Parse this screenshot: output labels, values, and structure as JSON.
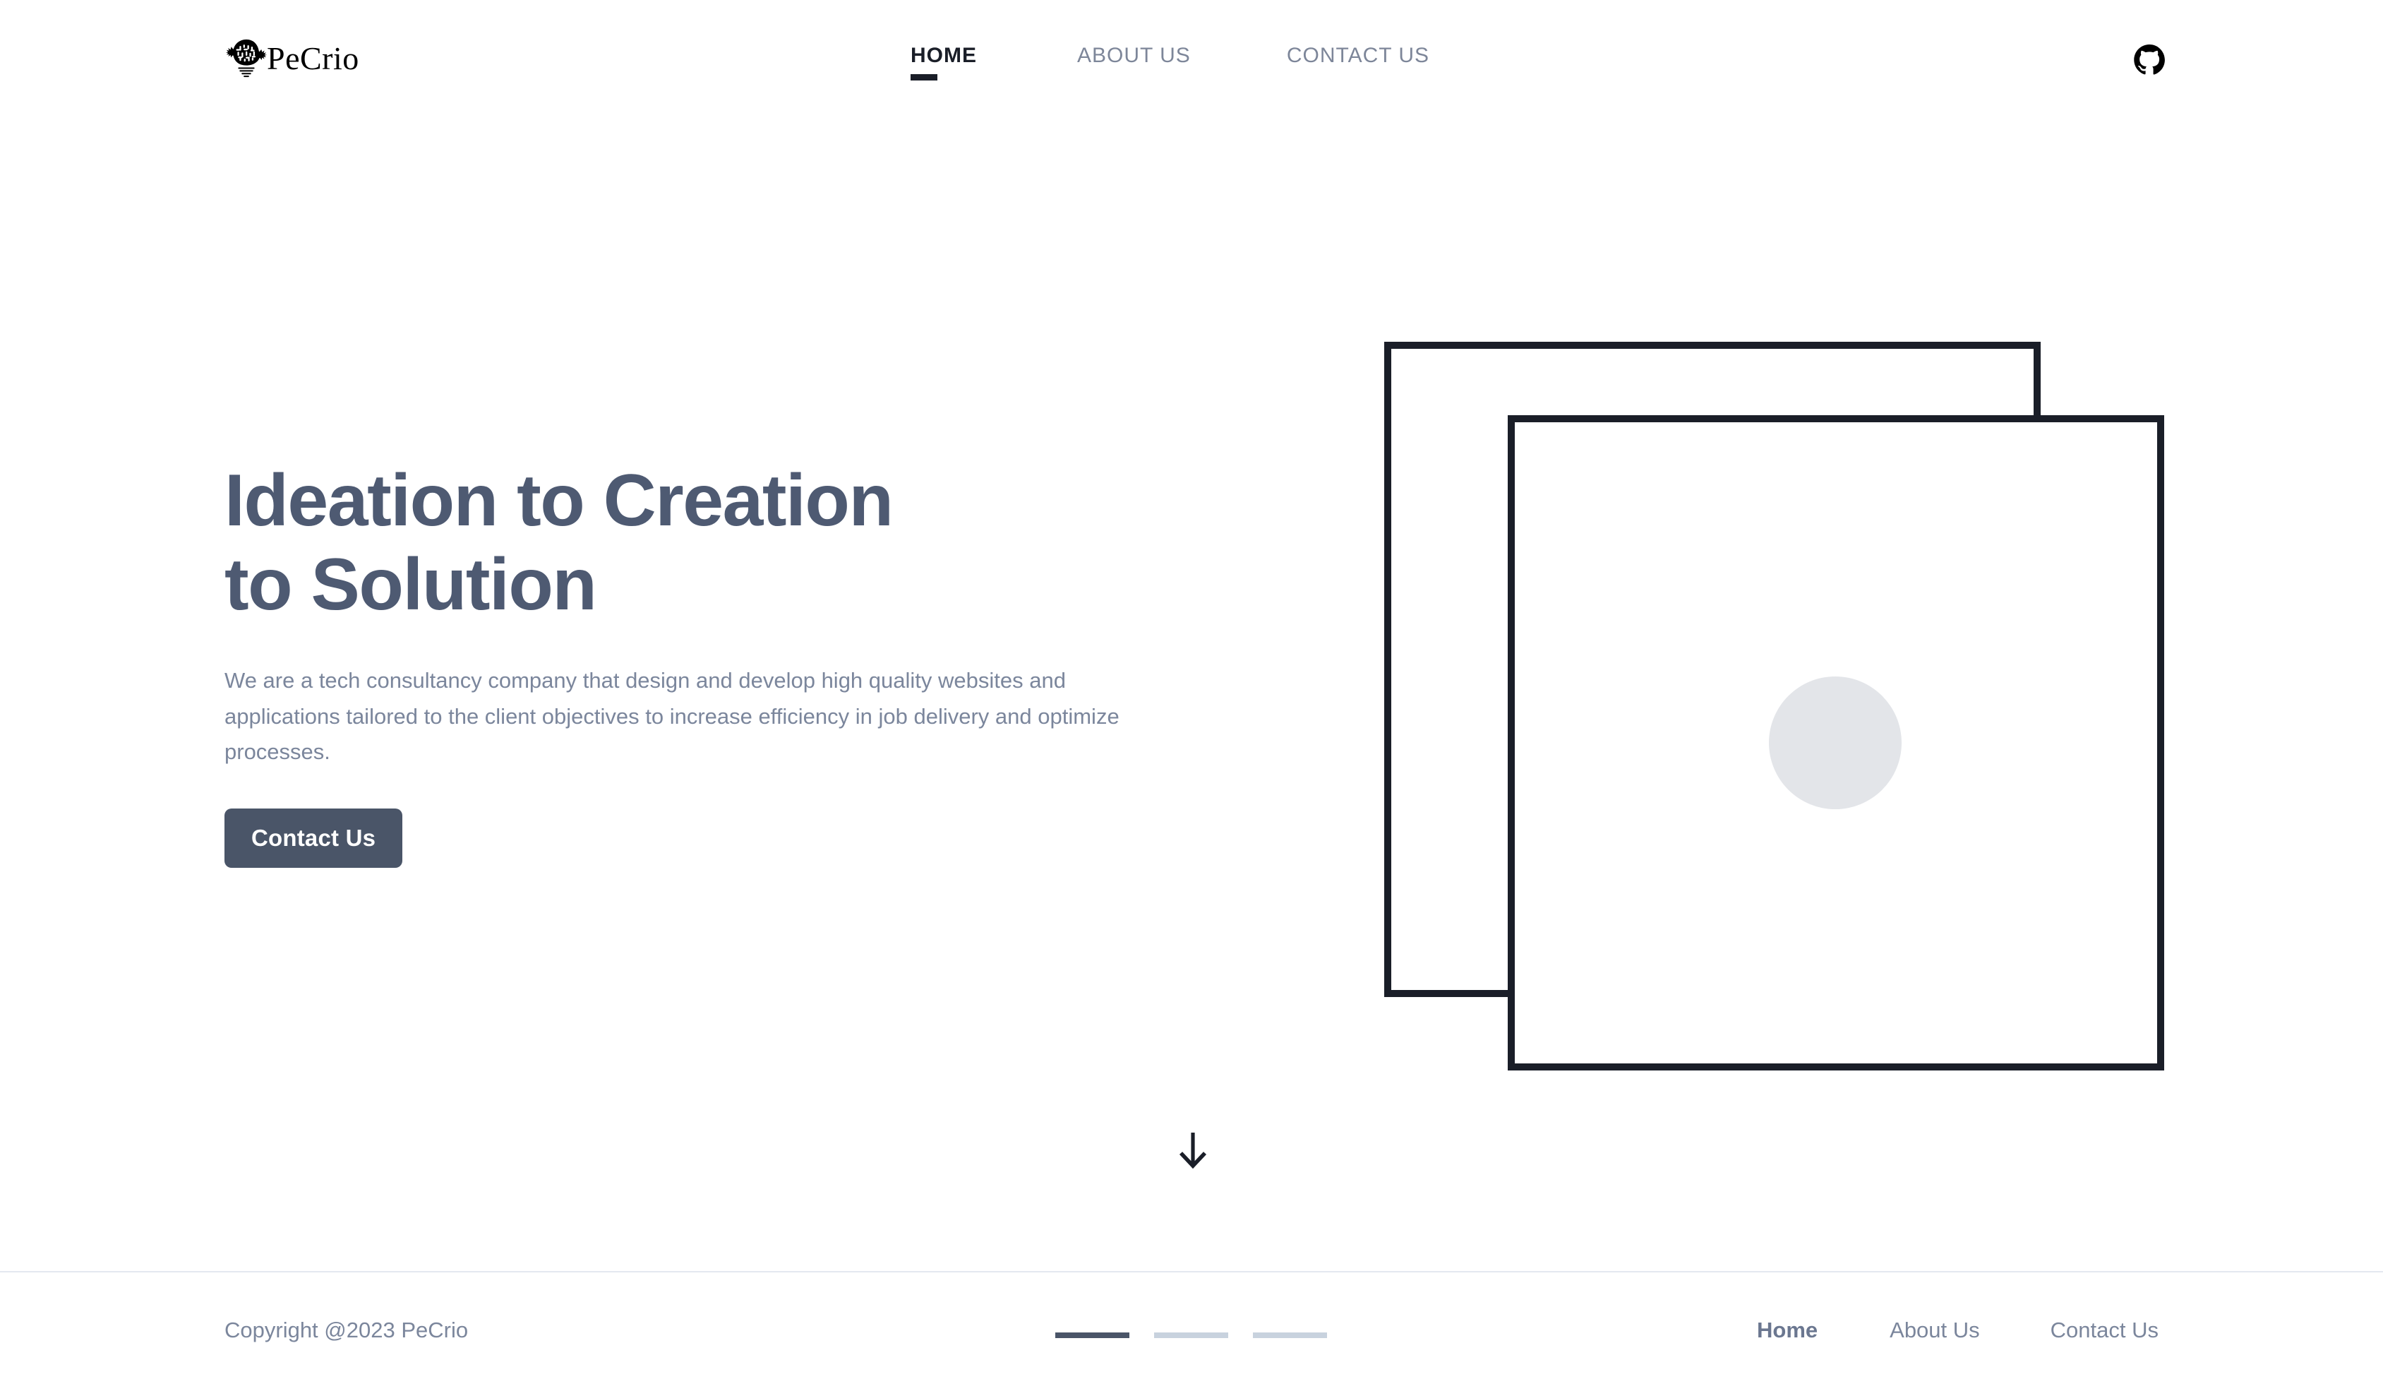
{
  "site": {
    "brand_name": "PeCrio",
    "brand_icon": "brain-lightbulb-icon"
  },
  "header": {
    "nav": [
      {
        "label": "HOME",
        "active": true
      },
      {
        "label": "ABOUT US",
        "active": false
      },
      {
        "label": "CONTACT US",
        "active": false
      }
    ],
    "github_icon": "github-icon"
  },
  "hero": {
    "title_line1": "Ideation to Creation",
    "title_line2": "to Solution",
    "subtitle": "We are a tech consultancy company that design and develop high quality websites and applications tailored to the client objectives to increase efficiency in job delivery and optimize processes.",
    "cta_label": "Contact Us",
    "scroll_icon": "arrow-down-icon"
  },
  "footer": {
    "copyright": "Copyright @2023 PeCrio",
    "pagination": [
      {
        "index": 1,
        "active": true
      },
      {
        "index": 2,
        "active": false
      },
      {
        "index": 3,
        "active": false
      }
    ],
    "nav": [
      {
        "label": "Home",
        "active": true
      },
      {
        "label": "About Us",
        "active": false
      },
      {
        "label": "Contact Us",
        "active": false
      }
    ]
  },
  "colors": {
    "heading": "#4e5a72",
    "body_text": "#7b869c",
    "accent_dark": "#1a1e28",
    "button_bg": "#4a5568",
    "circle_fill": "#e3e5e9",
    "divider": "#e4e8f0",
    "dot_inactive": "#c8d2de",
    "background": "#ffffff"
  }
}
